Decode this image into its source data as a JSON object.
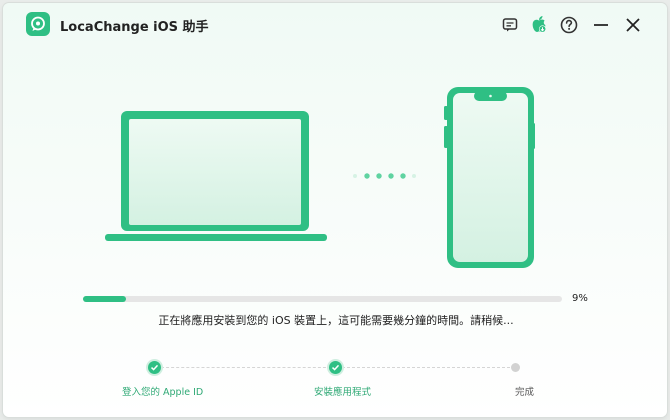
{
  "app": {
    "title": "LocaChange iOS 助手",
    "brand_color": "#2fbf84"
  },
  "titlebar_icons": [
    {
      "name": "feedback-icon"
    },
    {
      "name": "apple-icon"
    },
    {
      "name": "help-icon"
    },
    {
      "name": "minimize-icon"
    },
    {
      "name": "close-icon"
    }
  ],
  "illustration": {
    "laptop": "laptop-graphic",
    "phone": "iphone-graphic",
    "connection_dots": 5
  },
  "progress": {
    "value_percent": 9,
    "label": "9%",
    "status": "正在將應用安裝到您的 iOS 裝置上，這可能需要幾分鐘的時間。請稍候..."
  },
  "steps": [
    {
      "label": "登入您的 Apple ID",
      "state": "done"
    },
    {
      "label": "安裝應用程式",
      "state": "done"
    },
    {
      "label": "完成",
      "state": "pending"
    }
  ]
}
